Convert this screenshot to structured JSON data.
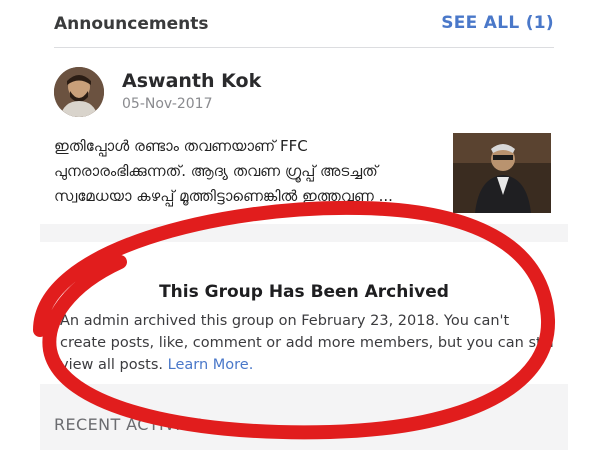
{
  "announcements": {
    "title": "Announcements",
    "see_all_label": "SEE ALL (1)"
  },
  "post": {
    "author": "Aswanth Kok",
    "date": "05-Nov-2017",
    "text_lines": [
      "ഇതിപ്പോൾ രണ്ടാം തവണയാണ് FFC",
      "പുനരാരംഭിക്കുന്നത്. ആദ്യ തവണ ഗ്രൂപ്പ് അടച്ചത്",
      "സ്വമേധയാ കഴപ്പ് മൂത്തിട്ടാണെങ്കിൽ ഇത്തവണ ..."
    ]
  },
  "archive_notice": {
    "title": "This Group Has Been Archived",
    "body": "An admin archived this group on February 23, 2018. You can't create posts, like, comment or add more members, but you can still view all posts.",
    "learn_more_label": "Learn More."
  },
  "recent_activity": {
    "label": "RECENT ACTIVITY"
  },
  "colors": {
    "link": "#4a78c9",
    "annotation_circle": "#e11d1d",
    "background": "#f4f4f5"
  }
}
